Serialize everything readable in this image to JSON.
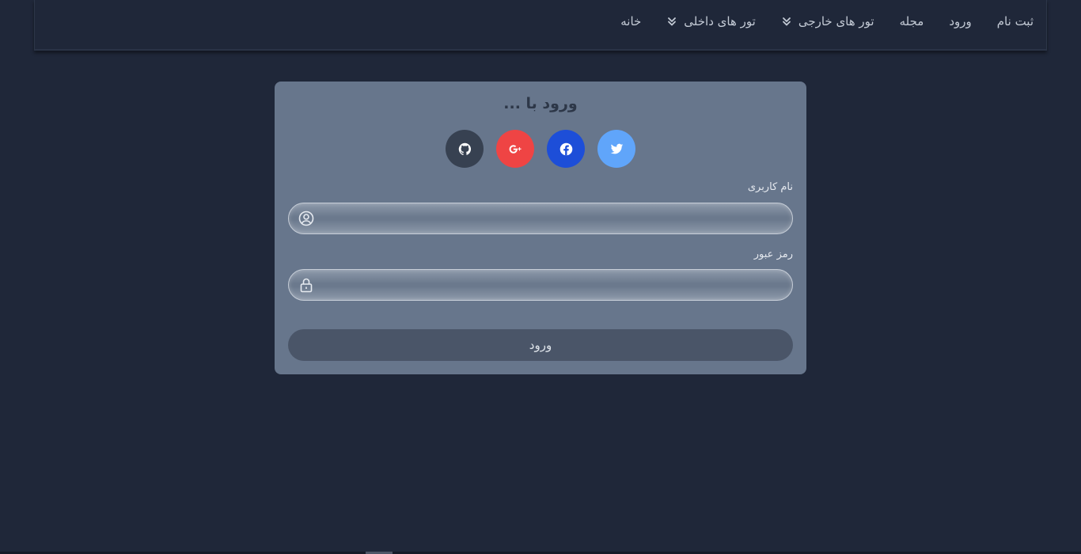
{
  "nav": {
    "items": [
      {
        "label": "ثبت نام",
        "icon": null
      },
      {
        "label": "ورود",
        "icon": null
      },
      {
        "label": "مجله",
        "icon": null
      },
      {
        "label": "تور های خارجی",
        "icon": "chevron-double-down-icon"
      },
      {
        "label": "تور های داخلی",
        "icon": "chevron-double-down-icon"
      },
      {
        "label": "خانه",
        "icon": null
      }
    ]
  },
  "login": {
    "title": "ورود با ...",
    "socials": [
      {
        "name": "twitter",
        "icon": "twitter-icon",
        "color": "#60a5fa"
      },
      {
        "name": "facebook",
        "icon": "facebook-icon",
        "color": "#1d4ed8"
      },
      {
        "name": "google-plus",
        "icon": "google-plus-icon",
        "color": "#ef4444"
      },
      {
        "name": "github",
        "icon": "github-icon",
        "color": "#374151"
      }
    ],
    "username_label": "نام کاربری",
    "username_value": "",
    "password_label": "رمز عبور",
    "password_value": "",
    "submit_label": "ورود"
  },
  "colors": {
    "background": "#1f2739",
    "card": "#67768c",
    "submit": "#4a5568"
  }
}
